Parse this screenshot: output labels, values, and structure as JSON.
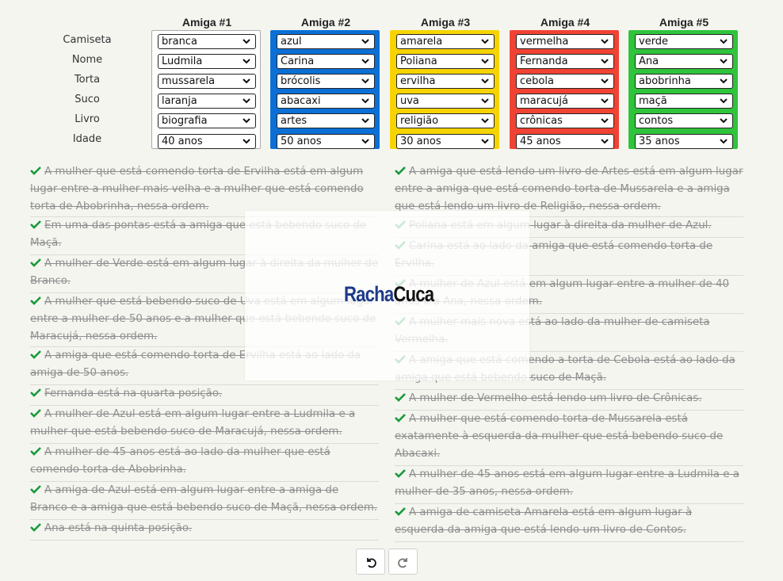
{
  "columns": [
    "Amiga #1",
    "Amiga #2",
    "Amiga #3",
    "Amiga #4",
    "Amiga #5"
  ],
  "colors": [
    "#ffffff",
    "#0b6fd6",
    "#f7d400",
    "#f04334",
    "#2fc43c"
  ],
  "attributes": [
    "Camiseta",
    "Nome",
    "Torta",
    "Suco",
    "Livro",
    "Idade"
  ],
  "values": [
    [
      "branca",
      "Ludmila",
      "mussarela",
      "laranja",
      "biografia",
      "40 anos"
    ],
    [
      "azul",
      "Carina",
      "brócolis",
      "abacaxi",
      "artes",
      "50 anos"
    ],
    [
      "amarela",
      "Poliana",
      "ervilha",
      "uva",
      "religião",
      "30 anos"
    ],
    [
      "vermelha",
      "Fernanda",
      "cebola",
      "maracujá",
      "crônicas",
      "45 anos"
    ],
    [
      "verde",
      "Ana",
      "abobrinha",
      "maçã",
      "contos",
      "35 anos"
    ]
  ],
  "clues_left": [
    "A mulher que está comendo torta de Ervilha está em algum lugar entre a mulher mais velha e a mulher que está comendo torta de Abobrinha, nessa ordem.",
    "Em uma das pontas está a amiga que está bebendo suco de Maçã.",
    "A mulher de Verde está em algum lugar à direita da mulher de Branco.",
    "A mulher que está bebendo suco de Uva está em algum lugar entre a mulher de 50 anos e a mulher que está bebendo suco de Maracujá, nessa ordem.",
    "A amiga que está comendo torta de Ervilha está ao lado da amiga de 50 anos.",
    "Fernanda está na quarta posição.",
    "A mulher de Azul está em algum lugar entre a Ludmila e a mulher que está bebendo suco de Maracujá, nessa ordem.",
    "A mulher de 45 anos está ao lado da mulher que está comendo torta de Abobrinha.",
    "A amiga de Azul está em algum lugar entre a amiga de Branco e a amiga que está bebendo suco de Maçã, nessa ordem.",
    "Ana está na quinta posição."
  ],
  "clues_right": [
    "A amiga que está lendo um livro de Artes está em algum lugar entre a amiga que está comendo torta de Mussarela e a amiga que está lendo um livro de Religião, nessa ordem.",
    "Poliana está em algum lugar à direita da mulher de Azul.",
    "Carina está ao lado da amiga que está comendo torta de Ervilha.",
    "A mulher de Azul está em algum lugar entre a mulher de 40 anos e a Ana, nessa ordem.",
    "A mulher mais nova está ao lado da mulher de camiseta Vermelha.",
    "A amiga que está comendo a torta de Cebola está ao lado da amiga que está bebendo suco de Maçã.",
    "A mulher de Vermelho está lendo um livro de Crônicas.",
    "A mulher que está comendo torta de Mussarela está exatamente à esquerda da mulher que está bebendo suco de Abacaxi.",
    "A mulher de 45 anos está em algum lugar entre a Ludmila e a mulher de 35 anos, nessa ordem.",
    "A amiga de camiseta Amarela está em algum lugar à esquerda da amiga que está lendo um livro de Contos."
  ],
  "logo": {
    "part1": "Racha",
    "part2": "Cuca"
  },
  "icons": {
    "clue_state": "check-icon",
    "undo": "undo-icon",
    "redo": "redo-icon",
    "dropdown": "chevron-down-icon"
  },
  "check_color": "#1a9a3a"
}
